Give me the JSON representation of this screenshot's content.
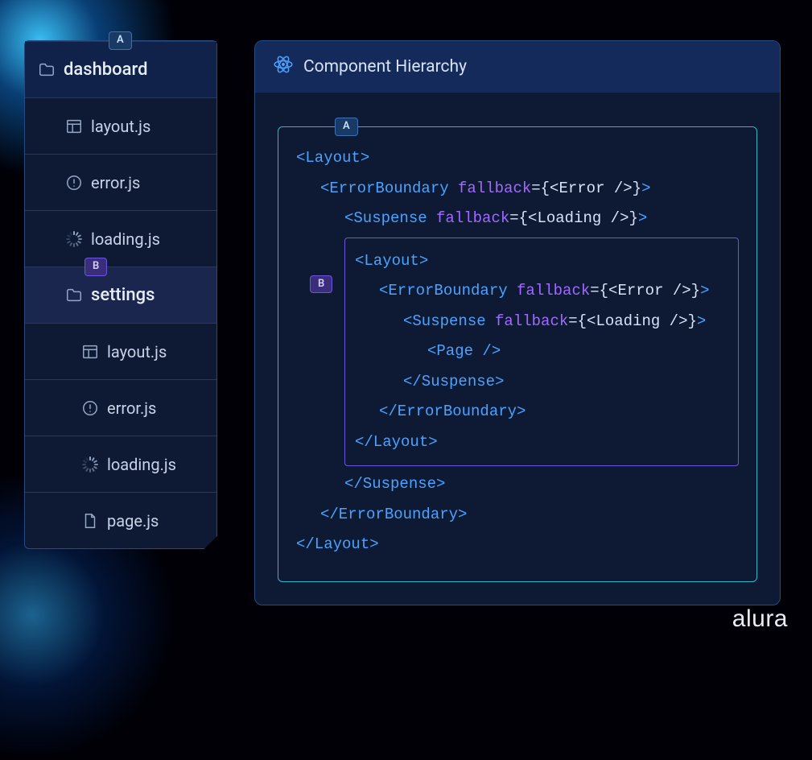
{
  "tags": {
    "a": "A",
    "b": "B"
  },
  "filetree": {
    "root": {
      "label": "dashboard"
    },
    "items": [
      {
        "label": "layout.js",
        "icon": "layout-icon"
      },
      {
        "label": "error.js",
        "icon": "alert-icon"
      },
      {
        "label": "loading.js",
        "icon": "spinner-icon"
      }
    ],
    "nested": {
      "folder": {
        "label": "settings"
      },
      "items": [
        {
          "label": "layout.js",
          "icon": "layout-icon"
        },
        {
          "label": "error.js",
          "icon": "alert-icon"
        },
        {
          "label": "loading.js",
          "icon": "spinner-icon"
        },
        {
          "label": "page.js",
          "icon": "file-icon"
        }
      ]
    }
  },
  "hierarchy": {
    "title": "Component Hierarchy",
    "outer": {
      "open_layout": "<Layout>",
      "open_eb": "<ErrorBoundary ",
      "fallback_kw": "fallback",
      "eq": "=",
      "err_frag": "{<Error />}",
      "close_ang": ">",
      "open_susp": "<Suspense ",
      "load_frag": "{<Loading />}",
      "close_susp": "</Suspense>",
      "close_eb": "</ErrorBoundary>",
      "close_layout": "</Layout>"
    },
    "inner": {
      "open_layout": "<Layout>",
      "open_eb": "<ErrorBoundary ",
      "open_susp": "<Suspense ",
      "page": "<Page />",
      "close_susp": "</Suspense>",
      "close_eb": "</ErrorBoundary>",
      "close_layout": "</Layout>"
    }
  },
  "watermark": "alura"
}
